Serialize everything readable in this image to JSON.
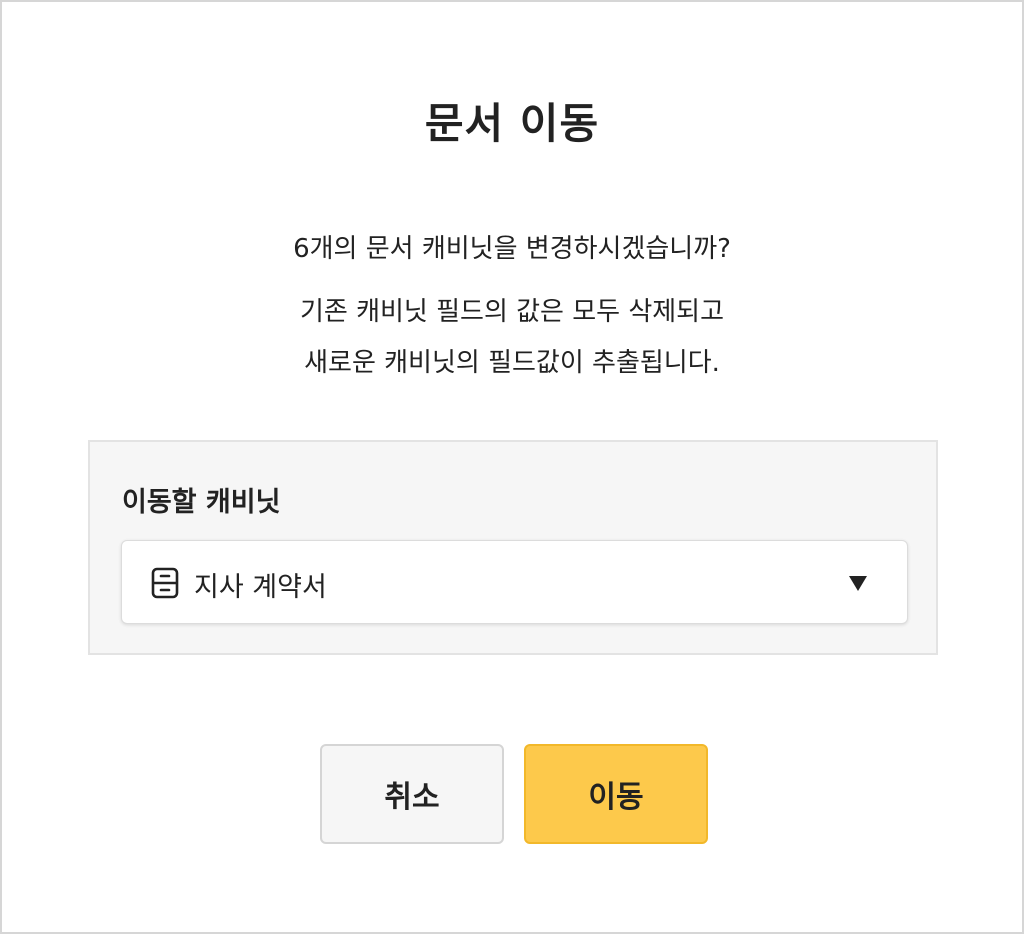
{
  "dialog": {
    "title": "문서 이동",
    "message_line1": "6개의 문서 캐비닛을 변경하시겠습니까?",
    "message_line2": "기존 캐비닛 필드의 값은 모두 삭제되고",
    "message_line3": "새로운 캐비닛의 필드값이 추출됩니다."
  },
  "cabinet_select": {
    "label": "이동할 캐비닛",
    "selected_value": "지사 계약서",
    "icon": "cabinet-icon",
    "dropdown_icon": "caret-down-icon"
  },
  "buttons": {
    "cancel_label": "취소",
    "confirm_label": "이동"
  },
  "colors": {
    "primary_button": "#fdc94b",
    "primary_border": "#f2b82a",
    "secondary_button": "#f6f6f6",
    "panel_background": "#f6f6f6",
    "text": "#222222"
  }
}
